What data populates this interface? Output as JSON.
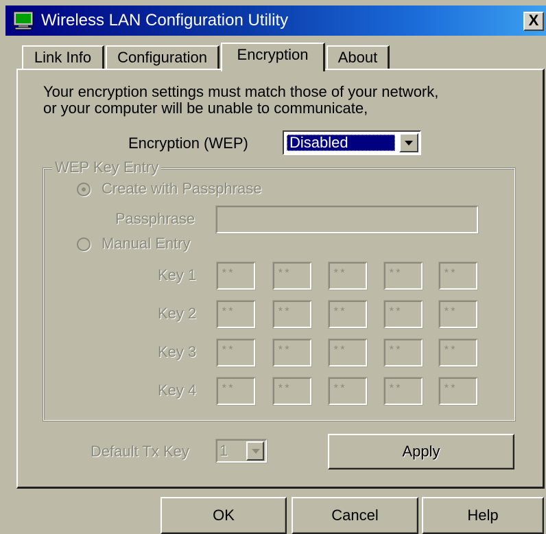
{
  "window": {
    "title": "Wireless LAN Configuration Utility",
    "close_label": "X"
  },
  "tabs": [
    {
      "label": "Link Info",
      "selected": false
    },
    {
      "label": "Configuration",
      "selected": false
    },
    {
      "label": "Encryption",
      "selected": true
    },
    {
      "label": "About",
      "selected": false
    }
  ],
  "encryption": {
    "description_line1": "Your encryption settings must match those of your network,",
    "description_line2": "or your computer will be unable to communicate,",
    "wep_label": "Encryption (WEP)",
    "wep_value": "Disabled"
  },
  "wep_key_entry": {
    "group_label": "WEP Key Entry",
    "create_with_passphrase_label": "Create with Passphrase",
    "create_with_passphrase_checked": true,
    "passphrase_label": "Passphrase",
    "passphrase_value": "",
    "manual_entry_label": "Manual Entry",
    "manual_entry_checked": false,
    "keys": [
      {
        "label": "Key 1",
        "fields": [
          "**",
          "**",
          "**",
          "**",
          "**"
        ]
      },
      {
        "label": "Key 2",
        "fields": [
          "**",
          "**",
          "**",
          "**",
          "**"
        ]
      },
      {
        "label": "Key 3",
        "fields": [
          "**",
          "**",
          "**",
          "**",
          "**"
        ]
      },
      {
        "label": "Key 4",
        "fields": [
          "**",
          "**",
          "**",
          "**",
          "**"
        ]
      }
    ]
  },
  "default_tx_key": {
    "label": "Default Tx Key",
    "value": "1"
  },
  "buttons": {
    "apply": "Apply",
    "ok": "OK",
    "cancel": "Cancel",
    "help": "Help"
  },
  "colors": {
    "dialog_background": "#bdbaa8",
    "titlebar_start": "#000080",
    "titlebar_end": "#3ca0f0",
    "selection": "#000080",
    "disabled_text": "#8c8a7c"
  },
  "icons": {
    "app_icon": "monitor-icon",
    "close_icon": "close-icon",
    "dropdown_icon": "chevron-down-icon"
  }
}
